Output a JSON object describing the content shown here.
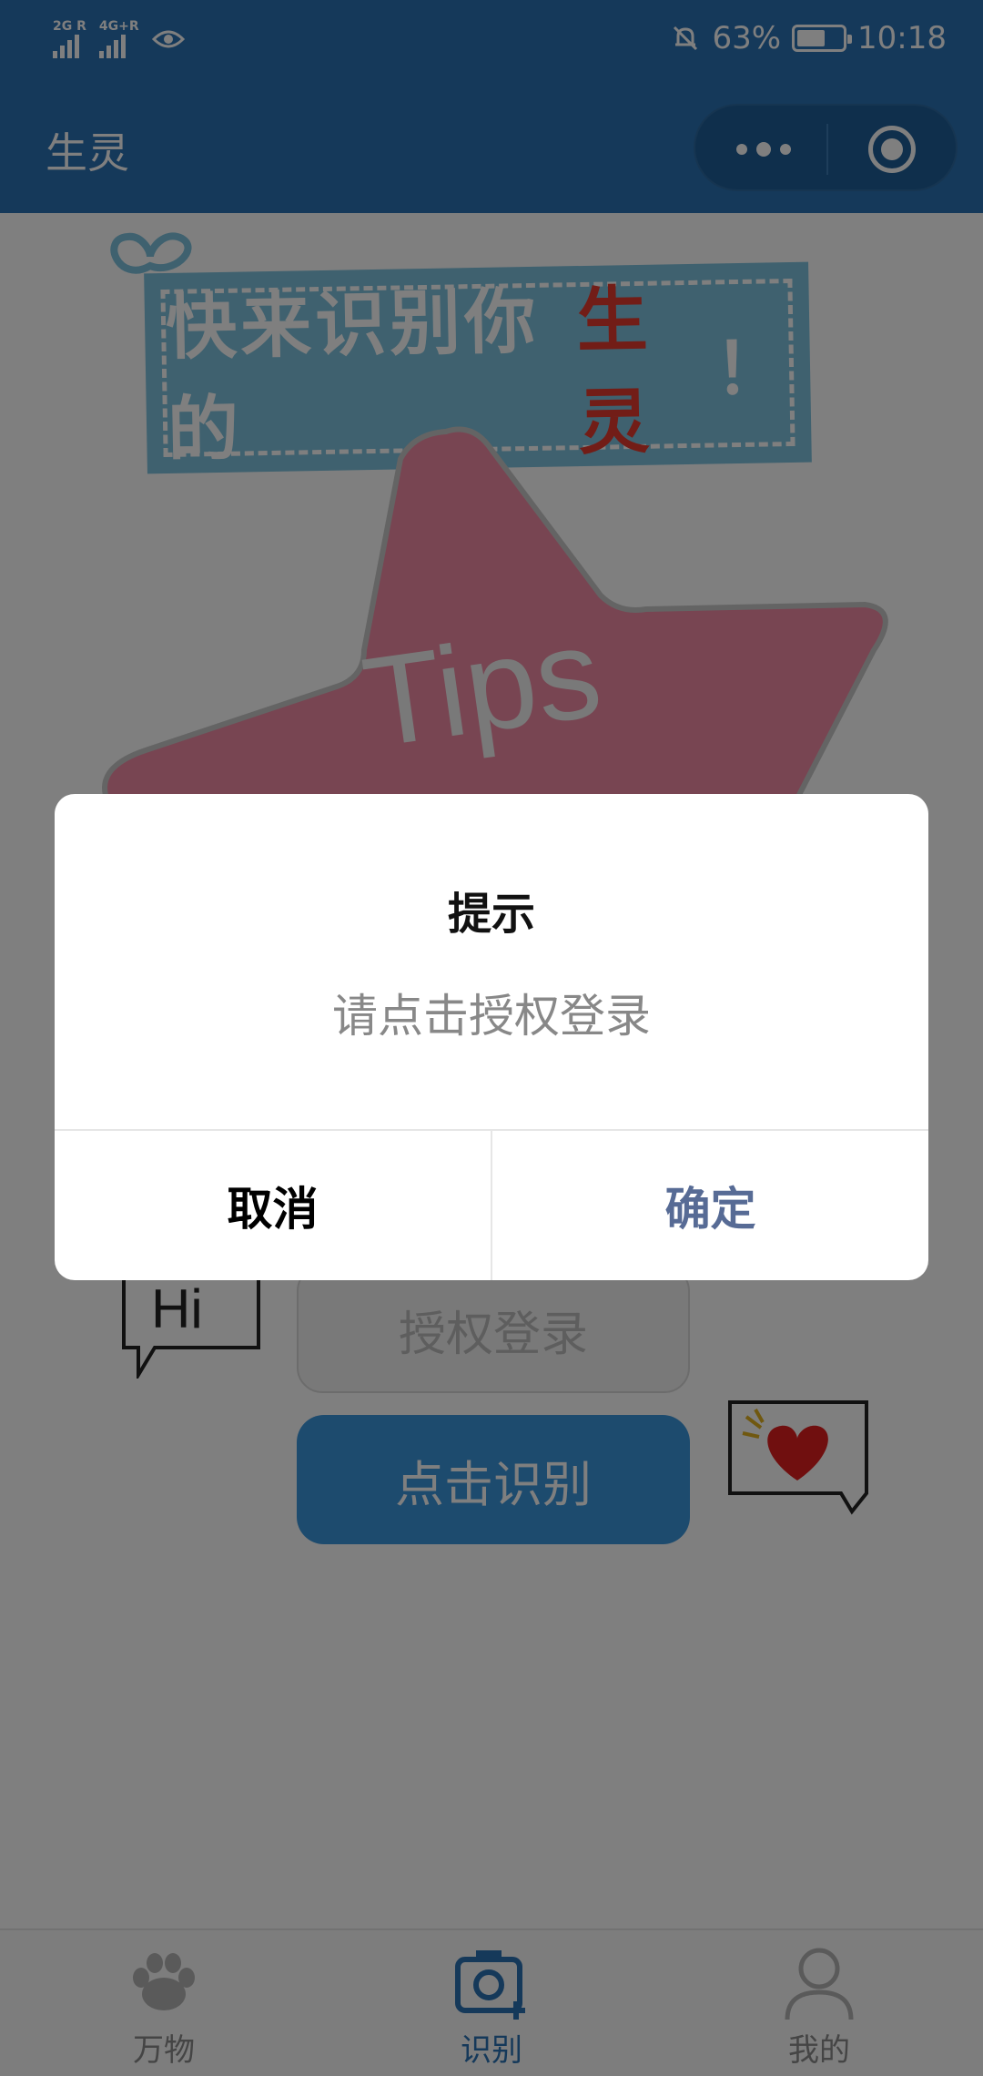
{
  "status_bar": {
    "sim1": "2G R",
    "sim2": "4G+R",
    "battery_percent": "63%",
    "time": "10:18",
    "battery_level": 0.63
  },
  "navbar": {
    "title": "生灵",
    "more_icon": "more-dots-icon",
    "close_icon": "target-close-icon"
  },
  "page": {
    "banner_text_prefix": "快来识别你的",
    "banner_text_highlight": "生灵",
    "banner_text_suffix": "！",
    "tips_text": "Tips",
    "hi_text": "Hi",
    "auth_button_label": "授权登录",
    "recognize_button_label": "点击识别",
    "colors": {
      "primary": "#2a72b4",
      "button_blue": "#3a96dd",
      "highlight_red": "#e53a2f",
      "star_pink": "#f08aa4",
      "banner_blue": "#7fc3de"
    }
  },
  "tabbar": {
    "items": [
      {
        "label": "万物",
        "icon": "paw-icon",
        "active": false
      },
      {
        "label": "识别",
        "icon": "camera-add-icon",
        "active": true
      },
      {
        "label": "我的",
        "icon": "user-icon",
        "active": false
      }
    ]
  },
  "modal": {
    "title": "提示",
    "content": "请点击授权登录",
    "cancel_label": "取消",
    "confirm_label": "确定"
  }
}
